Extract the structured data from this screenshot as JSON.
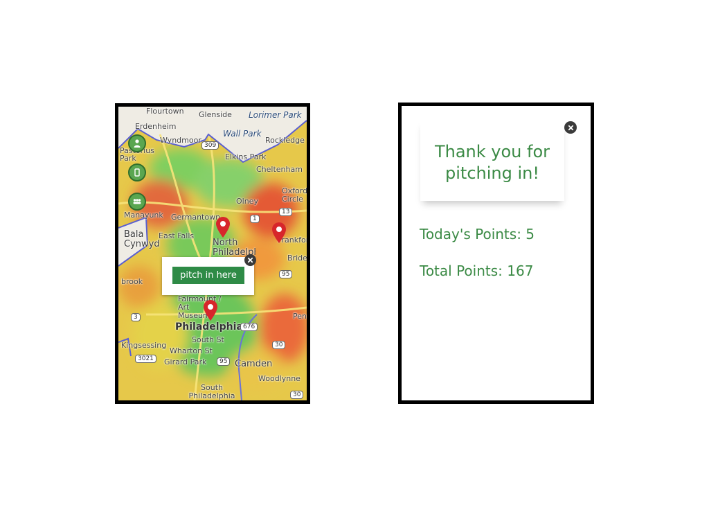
{
  "map_screen": {
    "labels": {
      "flourtown": "Flourtown",
      "glenside": "Glenside",
      "lorimer_park": "Lorimer Park",
      "erdenheim": "Erdenheim",
      "wyndmoor": "Wyndmoor",
      "wall_park": "Wall Park",
      "rockledge": "Rockledge",
      "pastorius_park": "Pastorius Park",
      "elkins_park": "Elkins Park",
      "cheltenham": "Cheltenham",
      "oxford_circle": "Oxford Circle",
      "olney": "Olney",
      "manayunk": "Manayunk",
      "germantown": "Germantown",
      "bala_cynwyd": "Bala Cynwyd",
      "east_falls": "East Falls",
      "north_philadelphia": "North Philadelphia",
      "frankford": "Frankford",
      "bridesburg": "Brides",
      "fairmount": "Fairmount / Art Museum",
      "brook": "brook",
      "philadelphia": "Philadelphia",
      "penn": "Pen",
      "south_st": "South St",
      "camden": "Camden",
      "kingsessing": "Kingsessing",
      "wharton": "Wharton St",
      "girard_park": "Girard Park",
      "woodlynne": "Woodlynne",
      "south_philadelphia": "South Philadelphia"
    },
    "shields": {
      "r309": "309",
      "r1": "1",
      "r13": "13",
      "r95a": "95",
      "r676": "676",
      "r3": "3",
      "r30a": "30",
      "r3021": "3021",
      "r95b": "95",
      "r30b": "30"
    },
    "popup_button": "pitch in here"
  },
  "thanks_screen": {
    "title": "Thank you for pitching in!",
    "todays_points": "Today's Points: 5",
    "total_points": "Total Points: 167"
  },
  "colors": {
    "accent_green": "#3b8a45",
    "button_green": "#2e8b46",
    "pin_red": "#d7262b"
  }
}
